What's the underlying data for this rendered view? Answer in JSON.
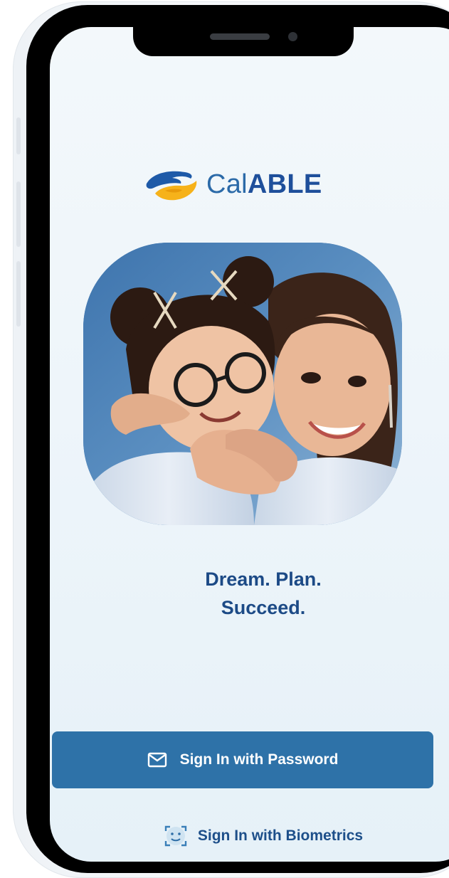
{
  "brand": {
    "name_light": "Cal",
    "name_bold": "ABLE",
    "primary_color": "#1e4f9b",
    "accent_color": "#f6b21a",
    "logo_icon": "hands-logo-icon"
  },
  "hero": {
    "image": "photo-two-women-hugging"
  },
  "tagline": {
    "line1": "Dream. Plan.",
    "line2": "Succeed."
  },
  "actions": {
    "password_label": "Sign In with Password",
    "password_icon": "mail-icon",
    "password_color": "#2e72a8",
    "biometrics_label": "Sign In with Biometrics",
    "biometrics_icon": "face-id-icon"
  }
}
